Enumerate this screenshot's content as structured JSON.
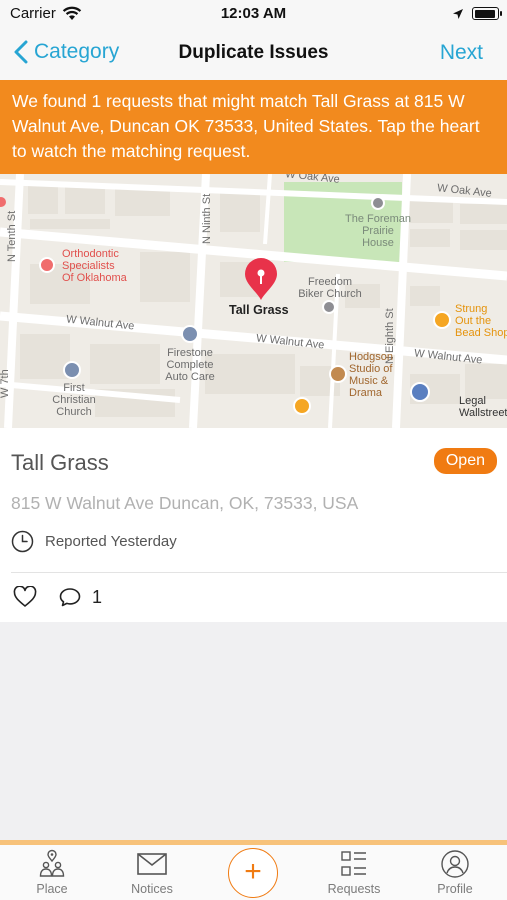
{
  "status_bar": {
    "carrier": "Carrier",
    "time": "12:03 AM"
  },
  "nav": {
    "back_label": "Category",
    "title": "Duplicate Issues",
    "next_label": "Next"
  },
  "banner": {
    "text": "We found 1 requests that might match Tall Grass at 815 W Walnut Ave, Duncan OK 73533, United States. Tap the heart to watch the matching request."
  },
  "map": {
    "labels": {
      "w_oak_ave_1": "W Oak Ave",
      "w_oak_ave_2": "W Oak Ave",
      "n_tenth_st": "N Tenth St",
      "n_ninth_st": "N Ninth St",
      "n_eighth_st": "N Eighth St",
      "w_walnut_ave_1": "W Walnut Ave",
      "w_walnut_ave_2": "W Walnut Ave",
      "w_walnut_ave_3": "W Walnut Ave",
      "w_7th": "W 7th",
      "foreman_1": "The Foreman",
      "foreman_2": "Prairie",
      "foreman_3": "House",
      "ortho_1": "Orthodontic",
      "ortho_2": "Specialists",
      "ortho_3": "Of Oklahoma",
      "freedom_1": "Freedom",
      "freedom_2": "Biker Church",
      "strung_1": "Strung",
      "strung_2": "Out the",
      "strung_3": "Bead Shop",
      "firestone_1": "Firestone",
      "firestone_2": "Complete",
      "firestone_3": "Auto Care",
      "hodgson_1": "Hodgson",
      "hodgson_2": "Studio of",
      "hodgson_3": "Music &",
      "hodgson_4": "Drama",
      "first_1": "First",
      "first_2": "Christian",
      "first_3": "Church",
      "legal": "Legal",
      "wallstreet": "Wallstreet"
    },
    "pin_label": "Tall Grass",
    "colors": {
      "pin": "#e8324a",
      "park": "#c8e6b8",
      "poi_gray": "#8e8e93"
    }
  },
  "issue": {
    "title": "Tall Grass",
    "status": "Open",
    "address": "815 W Walnut Ave Duncan, OK, 73533, USA",
    "reported": "Reported Yesterday",
    "comment_count": "1"
  },
  "tabs": {
    "place": "Place",
    "notices": "Notices",
    "add": "+",
    "requests": "Requests",
    "profile": "Profile"
  },
  "colors": {
    "accent_blue": "#27a5d3",
    "banner_orange": "#f28a1e",
    "status_orange": "#f07b12"
  }
}
